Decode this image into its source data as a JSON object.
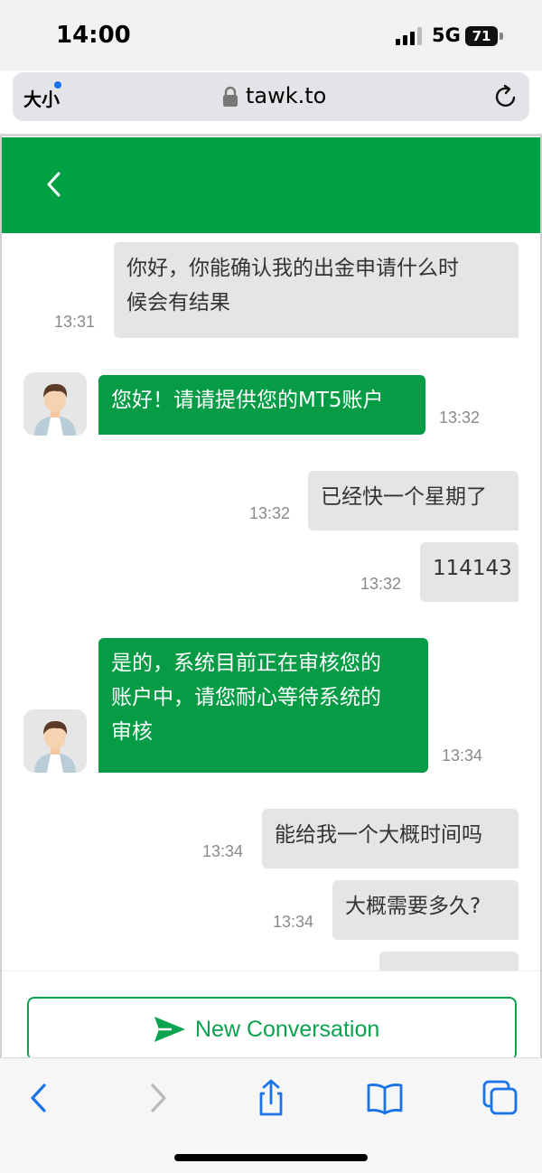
{
  "status_bar": {
    "time": "14:00",
    "network": "5G",
    "battery": "71"
  },
  "browser": {
    "aa_label": "大小",
    "domain": "tawk.to"
  },
  "messages": [
    {
      "sender": "visitor",
      "text": "你好，你能确认我的出金申请什么时\n候会有结果",
      "time": "13:31"
    },
    {
      "sender": "agent",
      "text": "您好！请请提供您的MT5账户",
      "time": "13:32"
    },
    {
      "sender": "visitor",
      "text": "已经快一个星期了",
      "time": "13:32"
    },
    {
      "sender": "visitor",
      "text": "114143",
      "time": "13:32"
    },
    {
      "sender": "agent",
      "text": "是的，系统目前正在审核您的\n账户中，请您耐心等待系统的\n审核",
      "time": "13:34"
    },
    {
      "sender": "visitor",
      "text": "能给我一个大概时间吗",
      "time": "13:34"
    },
    {
      "sender": "visitor",
      "text": "大概需要多久?",
      "time": "13:34"
    }
  ],
  "new_conversation_label": "New Conversation",
  "colors": {
    "brand_green": "#00a045",
    "agent_bubble": "#069b45",
    "visitor_bubble": "#e5e5e5",
    "safari_blue": "#1a73e8"
  },
  "icons": {
    "back": "chevron-left-icon",
    "lock": "lock-icon",
    "reload": "reload-icon",
    "send": "send-icon",
    "share": "share-icon",
    "bookmarks": "book-icon",
    "tabs": "tabs-icon"
  }
}
